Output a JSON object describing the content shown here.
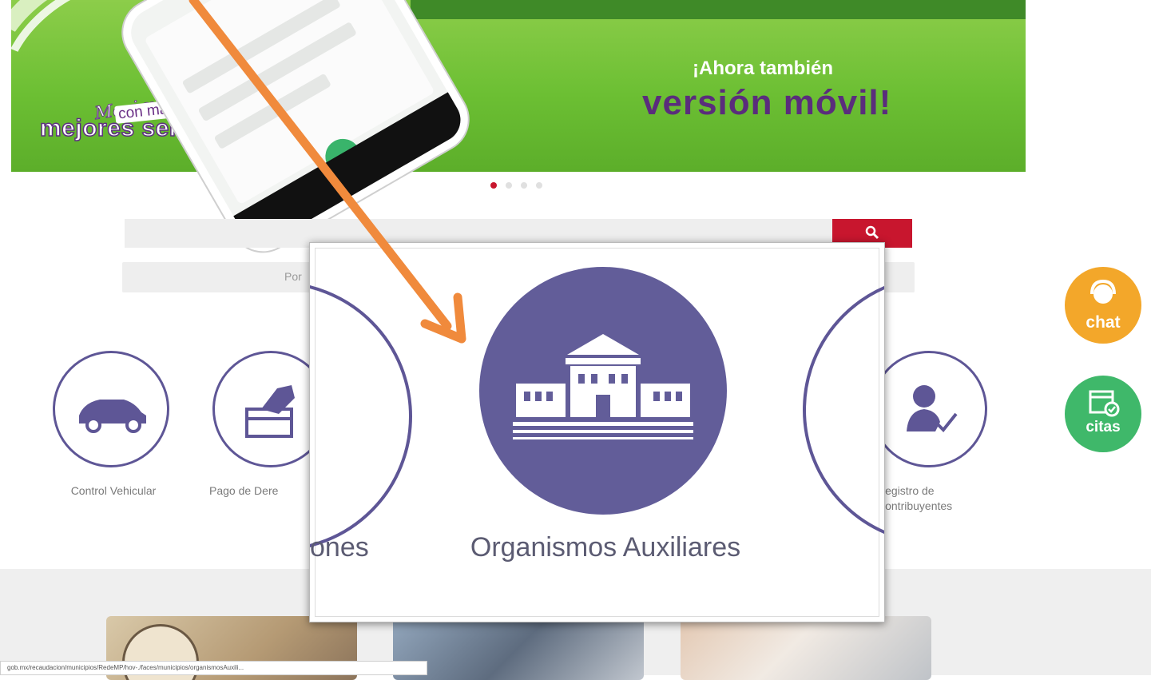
{
  "banner": {
    "tagline_script": "Mexiquenses",
    "tagline_mid": "con más y",
    "tagline_big": "mejores servicios",
    "headline_small": "¡Ahora también",
    "headline_big": "versión móvil!",
    "carousel_dots": 4,
    "active_dot": 1
  },
  "search": {
    "placeholder": "",
    "sub_text": "Por"
  },
  "services": [
    {
      "label": "Control Vehicular",
      "icon": "car-icon"
    },
    {
      "label": "Pago de Dere",
      "icon": "payment-card-icon"
    },
    {
      "label": "Registro de\nContribuyentes",
      "icon": "user-check-icon"
    }
  ],
  "popup": {
    "title": "Organismos Auxiliares",
    "left_partial": "ones",
    "icon": "government-building-icon"
  },
  "side_buttons": {
    "chat_label": "chat",
    "citas_label": "citas"
  },
  "status_bar": {
    "url": "gob.mx/recaudacion/municipios/RedeMP/hov-./faces/municipios/organismosAuxili..."
  },
  "colors": {
    "brand_green": "#6cbf33",
    "brand_purple": "#5e5696",
    "search_red": "#c8162e",
    "chat_orange": "#f3a72a",
    "citas_green": "#3fb86a",
    "arrow_orange": "#f08a3c"
  }
}
